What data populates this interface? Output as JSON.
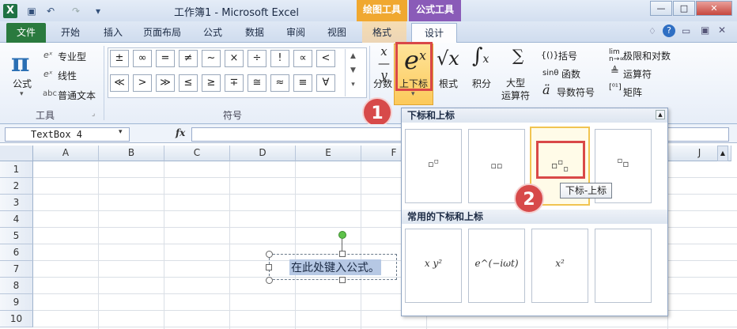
{
  "window": {
    "title": "工作簿1 - Microsoft Excel",
    "context_draw": "绘图工具",
    "context_formula": "公式工具",
    "minimize": "—",
    "restore": "□",
    "close": "✕"
  },
  "tabs": [
    "文件",
    "开始",
    "插入",
    "页面布局",
    "公式",
    "数据",
    "审阅",
    "视图",
    "格式",
    "设计"
  ],
  "ribbon": {
    "tools_group": {
      "formula": "公式",
      "professional": "专业型",
      "linear": "线性",
      "plain_text": "普通文本",
      "label": "工具"
    },
    "symbols_group": {
      "label": "符号",
      "row1": [
        "±",
        "∞",
        "=",
        "≠",
        "~",
        "×",
        "÷",
        "!",
        "∝",
        "<"
      ],
      "row2": [
        "≪",
        ">",
        "≫",
        "≤",
        "≥",
        "∓",
        "≅",
        "≈",
        "≡",
        "∀"
      ]
    },
    "structures": {
      "fraction": "分数",
      "script": "上下标",
      "radical": "根式",
      "integral": "积分",
      "large_operator": "大型\n运算符",
      "bracket": "括号",
      "function": "函数",
      "accent": "导数符号",
      "limit_log": "极限和对数",
      "operator": "运算符",
      "matrix": "矩阵"
    }
  },
  "formula_bar": {
    "name_box": "TextBox 4",
    "fx": "fx"
  },
  "columns": [
    "A",
    "B",
    "C",
    "D",
    "E",
    "F",
    "",
    "",
    "",
    "J"
  ],
  "rows": [
    "1",
    "2",
    "3",
    "4",
    "5",
    "6",
    "7",
    "8",
    "9",
    "10"
  ],
  "panel": {
    "section1": "下标和上标",
    "section2": "常用的下标和上标",
    "common": [
      "x y²",
      "e^(−iωt)",
      "x²",
      ""
    ],
    "tooltip": "下标-上标"
  },
  "callouts": [
    "1",
    "2"
  ],
  "textbox": "在此处键入公式。"
}
